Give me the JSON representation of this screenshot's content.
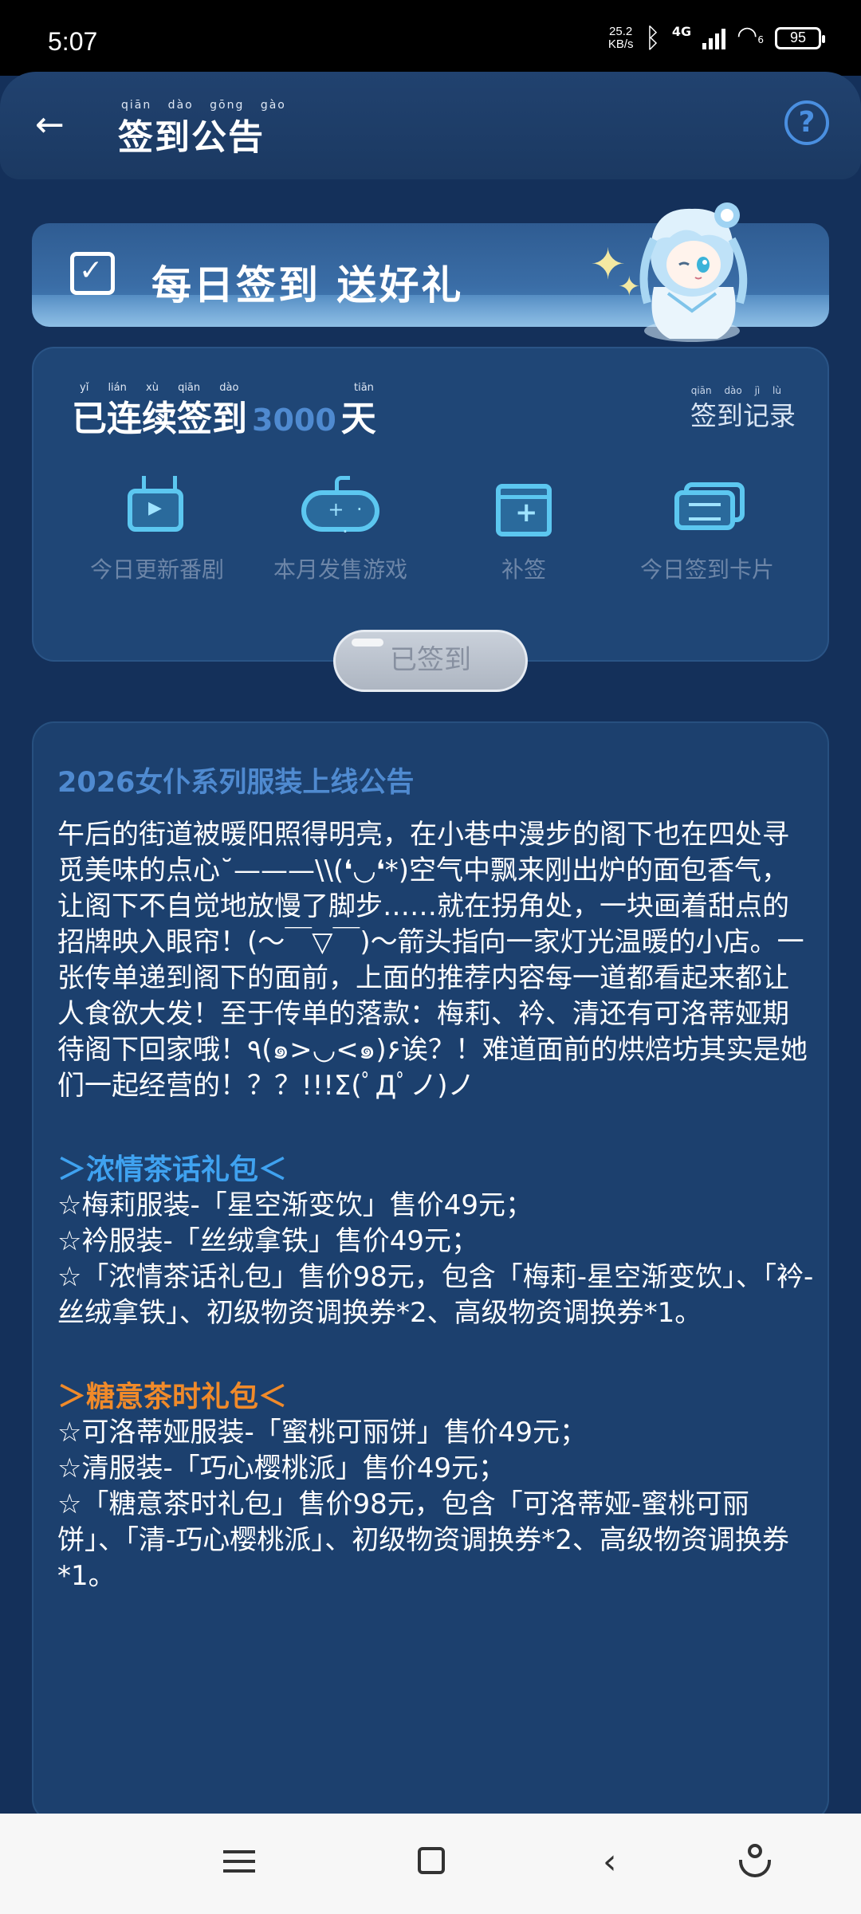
{
  "status_bar": {
    "time": "5:07",
    "net_speed": "25.2",
    "net_unit": "KB/s",
    "network": "4G",
    "wifi_sub": "6",
    "battery": "95"
  },
  "header": {
    "title": "签到公告",
    "title_pinyin": "qiān dào gōng gào",
    "back_icon": "arrow-left-icon",
    "help_icon": "question-circle-icon"
  },
  "banner": {
    "text": "每日签到 送好礼"
  },
  "checkin": {
    "streak_prefix": "已连续签到",
    "streak_pinyin": "yǐ lián xù qiān dào",
    "streak_days": "3000",
    "streak_suffix": "天",
    "suffix_pinyin": "tiān",
    "records_label": "签到记录",
    "records_pinyin": "qiān dào jì lù",
    "features": [
      {
        "label": "今日更新番剧",
        "icon": "tv-icon"
      },
      {
        "label": "本月发售游戏",
        "icon": "gamepad-icon"
      },
      {
        "label": "补签",
        "icon": "calendar-plus-icon"
      },
      {
        "label": "今日签到卡片",
        "icon": "cards-icon"
      }
    ],
    "signed_button": "已签到"
  },
  "notice": {
    "title": "2026女仆系列服装上线公告",
    "intro": "午后的街道被暖阳照得明亮，在小巷中漫步的阁下也在四处寻觅美味的点心˘———\\\\(❛◡❛*)空气中飘来刚出炉的面包香气，让阁下不自觉地放慢了脚步……就在拐角处，一块画着甜点的招牌映入眼帘！(〜￣▽￣)〜箭头指向一家灯光温暖的小店。一张传单递到阁下的面前，上面的推荐内容每一道都看起来都让人食欲大发！至于传单的落款：梅莉、衿、清还有可洛蒂娅期待阁下回家哦！٩(๑>◡<๑)۶诶？！难道面前的烘焙坊其实是她们一起经营的！？？!!!Σ(ﾟДﾟノ)ノ",
    "pack1": {
      "heading": "＞浓情茶话礼包＜",
      "lines": [
        "☆梅莉服装-「星空渐变饮」售价49元；",
        "☆衿服装-「丝绒拿铁」售价49元；",
        "☆「浓情茶话礼包」售价98元，包含「梅莉-星空渐变饮」、「衿-丝绒拿铁」、初级物资调换券*2、高级物资调换券*1。"
      ]
    },
    "pack2": {
      "heading": "＞糖意茶时礼包＜",
      "lines": [
        "☆可洛蒂娅服装-「蜜桃可丽饼」售价49元；",
        "☆清服装-「巧心樱桃派」售价49元；",
        "☆「糖意茶时礼包」售价98元，包含「可洛蒂娅-蜜桃可丽饼」、「清-巧心樱桃派」、初级物资调换券*2、高级物资调换券*1。"
      ]
    }
  },
  "colors": {
    "background": "#14305a",
    "accent_blue": "#4f8ad0",
    "pack_blue": "#3fa2f0",
    "pack_orange": "#f08a2a"
  }
}
